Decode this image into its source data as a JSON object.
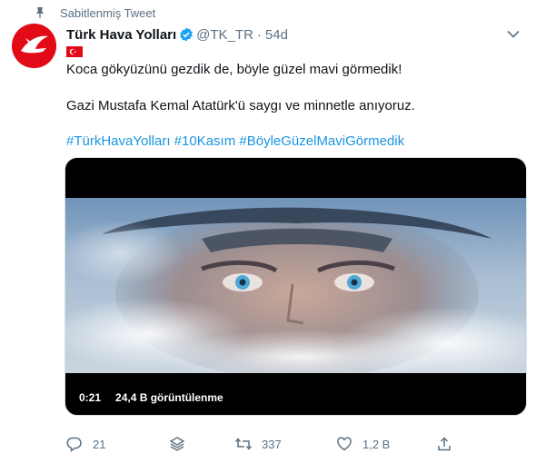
{
  "pinned": {
    "label": "Sabitlenmiş Tweet"
  },
  "author": {
    "name": "Türk Hava Yolları",
    "handle": "@TK_TR",
    "separator": "·",
    "time": "54d"
  },
  "tweet": {
    "line1": "Koca gökyüzünü gezdik de, böyle güzel mavi görmedik!",
    "line2": "Gazi Mustafa Kemal Atatürk'ü saygı ve minnetle anıyoruz.",
    "hashtags": [
      "#TürkHavaYolları",
      "#10Kasım",
      "#BöyleGüzelMaviGörmedik"
    ]
  },
  "video": {
    "duration": "0:21",
    "views": "24,4 B görüntülenme"
  },
  "actions": {
    "reply_count": "21",
    "retweet_count": "337",
    "like_count": "1,2 B"
  },
  "colors": {
    "link": "#1b95e0",
    "muted": "#5b7083",
    "brand_red": "#e30a17",
    "verified": "#1da1f2"
  }
}
